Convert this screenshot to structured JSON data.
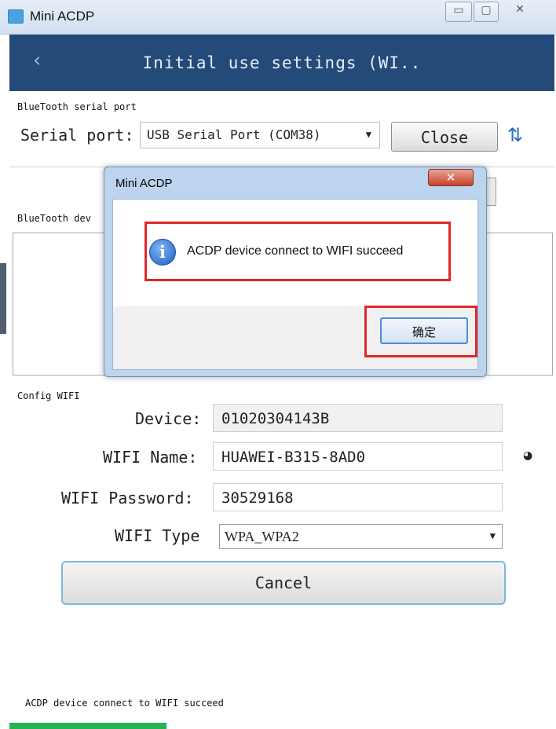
{
  "window": {
    "title": "Mini ACDP",
    "min_glyph": "▭",
    "max_glyph": "▢",
    "close_glyph": "✕"
  },
  "header": {
    "back_glyph": "‹",
    "title": "Initial use settings (WI.."
  },
  "bluetooth_serial": {
    "section_label": "BlueTooth serial port",
    "serial_label": "Serial port:",
    "serial_value": "USB Serial Port (COM38)",
    "close_label": "Close",
    "refresh_icon": "refresh-icon",
    "refresh_glyph": "⇅"
  },
  "bluetooth_devices": {
    "section_label": "BlueTooth dev"
  },
  "config_wifi": {
    "section_label": "Config WIFI",
    "device_label": "Device:",
    "device_value": "01020304143B",
    "wifi_name_label": "WIFI Name:",
    "wifi_name_value": "HUAWEI-B315-8AD0",
    "wifi_password_label": "WIFI Password:",
    "wifi_password_value": "30529168",
    "wifi_type_label": "WIFI Type",
    "wifi_type_value": "WPA_WPA2",
    "eye_glyph": "◕",
    "cancel_label": "Cancel"
  },
  "status": {
    "text": "ACDP device connect to WIFI succeed"
  },
  "dialog": {
    "title": "Mini ACDP",
    "close_glyph": "✕",
    "info_glyph": "i",
    "message": "ACDP device connect to WIFI succeed",
    "ok_label": "确定"
  },
  "colors": {
    "header_bg": "#234a78",
    "highlight": "#e0262a",
    "progress": "#27b255"
  }
}
